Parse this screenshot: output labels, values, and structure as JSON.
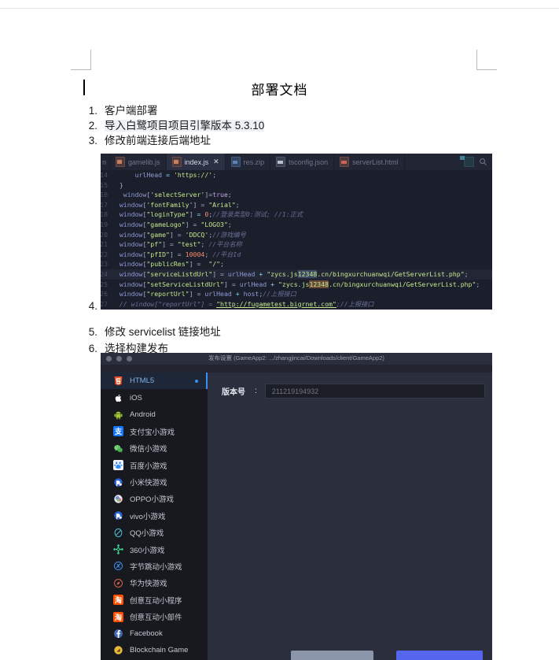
{
  "document": {
    "title": "部署文档",
    "list": [
      {
        "num": "1.",
        "text": "客户端部署"
      },
      {
        "num": "2.",
        "text": "导入白鹭项目项目引擎版本 5.3.10"
      },
      {
        "num": "3.",
        "text": "修改前端连接后端地址"
      },
      {
        "num": "4.",
        "text": ""
      },
      {
        "num": "5.",
        "text": "修改 servicelist 链接地址"
      },
      {
        "num": "6.",
        "text": "选择构建发布"
      }
    ]
  },
  "code_editor": {
    "tabs": [
      {
        "label": "n",
        "icon": "file-icon",
        "active": false,
        "truncated": true
      },
      {
        "label": "gamelib.js",
        "icon": "js-file-icon",
        "active": false
      },
      {
        "label": "index.js",
        "icon": "js-file-icon",
        "active": true,
        "close": "✕"
      },
      {
        "label": "res.zip",
        "icon": "zip-file-icon",
        "active": false
      },
      {
        "label": "tsconfig.json",
        "icon": "json-file-icon",
        "active": false
      },
      {
        "label": "serverList.html",
        "icon": "html-file-icon",
        "active": false
      }
    ],
    "toolbar_icons": [
      "split-editor-icon",
      "search-file-icon"
    ],
    "lines": [
      {
        "n": "14",
        "text": "        urlHead = 'https://';"
      },
      {
        "n": "15",
        "text": "    }"
      },
      {
        "n": "16",
        "text": "     window['selectServer']=true;"
      },
      {
        "n": "17",
        "text": "    window['fontFamily'] = \"Arial\";"
      },
      {
        "n": "18",
        "text": "    window[\"loginType\"] = 0;//登录类型0:测试; //1:正式"
      },
      {
        "n": "19",
        "text": "    window[\"gameLogo\"] = \"LOGO3\";"
      },
      {
        "n": "20",
        "text": "    window[\"game\"] = 'DDCQ';//游戏编号"
      },
      {
        "n": "21",
        "text": "    window[\"pf\"] = \"test\"; //平台名称"
      },
      {
        "n": "22",
        "text": "    window[\"pfID\"] = 10004; //平台Id"
      },
      {
        "n": "23",
        "text": "    window[\"publicRes\"] =  \"/\";"
      },
      {
        "n": "24",
        "text": "    window[\"serviceListdUrl\"] = urlHead + \"zycs.js12348.cn/bingxurchuanwqi/GetServerList.php\";"
      },
      {
        "n": "25",
        "text": "    window[\"setServiceListdUrl\"] = urlHead + \"zycs.js12348.cn/bingxurchuanwqi/GetServerList.php\";"
      },
      {
        "n": "26",
        "text": "    window[\"reportUrl\"] = urlHead + host;//上报接口"
      },
      {
        "n": "27",
        "text": "    // window[\"reportUrl\"] = \"http://fugametest.bigrnet.com\";//上报接口"
      }
    ],
    "highlight_token": "12348"
  },
  "publish_dialog": {
    "window_title": "发布设置 (GameApp2:  .../zhangjincai/Downloads/client/GameApp2)",
    "traffic_lights": [
      "close",
      "minimize",
      "zoom"
    ],
    "sidebar": [
      {
        "label": "HTML5",
        "icon": "html5-icon",
        "selected": true,
        "badge": "•",
        "color": "#e44d26"
      },
      {
        "label": "iOS",
        "icon": "apple-icon",
        "color": "#ffffff"
      },
      {
        "label": "Android",
        "icon": "android-icon",
        "color": "#a4c639"
      },
      {
        "label": "支付宝小游戏",
        "icon": "alipay-icon",
        "color": "#1677ff"
      },
      {
        "label": "微信小游戏",
        "icon": "wechat-icon",
        "color": "#07c160"
      },
      {
        "label": "百度小游戏",
        "icon": "baidu-icon",
        "color": "#3388ff"
      },
      {
        "label": "小米快游戏",
        "icon": "xiaomi-icon",
        "color": "#2a63d8"
      },
      {
        "label": "OPPO小游戏",
        "icon": "oppo-icon",
        "color": "#b0b4bd"
      },
      {
        "label": "vivo小游戏",
        "icon": "vivo-icon",
        "color": "#2a63d8"
      },
      {
        "label": "QQ小游戏",
        "icon": "qq-icon",
        "color": "#4fc3d9"
      },
      {
        "label": "360小游戏",
        "icon": "360-icon",
        "color": "#3ddc97"
      },
      {
        "label": "字节跳动小游戏",
        "icon": "bytedance-icon",
        "color": "#3d8ef0"
      },
      {
        "label": "华为快游戏",
        "icon": "huawei-icon",
        "color": "#d9614c"
      },
      {
        "label": "创意互动小程序",
        "icon": "taobao-icon",
        "color": "#ff5000"
      },
      {
        "label": "创意互动小部件",
        "icon": "taobao-icon",
        "color": "#ff5000"
      },
      {
        "label": "Facebook",
        "icon": "facebook-icon",
        "color": "#4267b2"
      },
      {
        "label": "Blockchain Game",
        "icon": "blockchain-icon",
        "color": "#e8b93b"
      }
    ],
    "form": {
      "version_label": "版本号",
      "colon": ":",
      "version_value": "211219194932"
    },
    "buttons": {
      "cancel": "",
      "confirm": ""
    }
  },
  "colors": {
    "editor_bg": "#1b1e2b",
    "tabbar_bg": "#222634",
    "dialog_bg": "#2b2f3d",
    "sidebar_bg": "#17191f",
    "accent": "#3d8ef0",
    "string_green": "#c3e88d",
    "comment_gray": "#697098",
    "primary_button": "#5566ee"
  }
}
